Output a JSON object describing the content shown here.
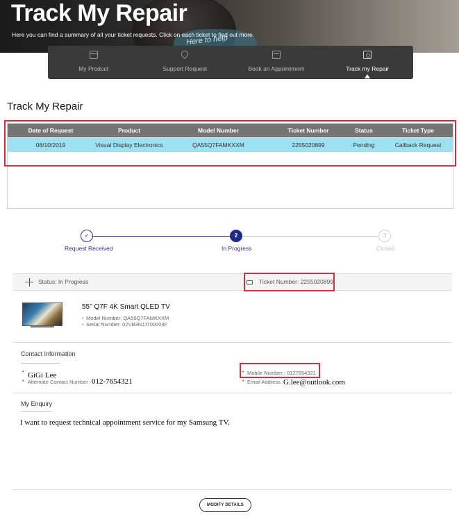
{
  "hero": {
    "title": "Track My Repair",
    "subtitle": "Here you can find a summary of all your ticket requests. Click on each ticket to find out more.",
    "shirt_text": "Here to help"
  },
  "tabs": [
    {
      "label": "My Product",
      "icon": "box-icon",
      "active": false
    },
    {
      "label": "Support Request",
      "icon": "location-pin-icon",
      "active": false
    },
    {
      "label": "Book an Appointment",
      "icon": "calendar-icon",
      "active": false
    },
    {
      "label": "Track my Repair",
      "icon": "clock-icon",
      "active": true
    }
  ],
  "section_title": "Track My Repair",
  "table": {
    "headers": [
      "Date of Request",
      "Product",
      "Model Number",
      "Ticket Number",
      "Status",
      "Ticket Type"
    ],
    "rows": [
      [
        "08/10/2019",
        "Visual Display Electronics",
        "QA55Q7FAMKXXM",
        "2255020899",
        "Pending",
        "Callback Request"
      ]
    ]
  },
  "progress": {
    "steps": [
      {
        "number": "✓",
        "label": "Request Received",
        "state": "done"
      },
      {
        "number": "2",
        "label": "In Progress",
        "state": "current"
      },
      {
        "number": "3",
        "label": "Closed",
        "state": "pending"
      }
    ]
  },
  "status": {
    "status_text": "Status: In Progress",
    "ticket_text": "Ticket Number: 2255020899"
  },
  "product": {
    "name": "55\" Q7F 4K Smart QLED TV",
    "model": "Model Number: QA55Q7FAMKXXM",
    "serial": "Serial Number: 02VB3NJJ700004F"
  },
  "contact": {
    "title": "Contact Information",
    "name": "GiGi Lee",
    "alt_label": "Alternate Contact Number :",
    "alt_value": "012-7654321",
    "mobile_label": "Mobile Number : 0127654321",
    "email_label": "Email Address :",
    "email_value": "G.lee@outlook.com"
  },
  "enquiry": {
    "title": "My Enquiry",
    "text": "I want to request technical appointment service for my Samsung TV."
  },
  "modify_button": "MODIFY DETAILS",
  "colors": {
    "highlight": "#d0313c",
    "accent_blue": "#1f2a85",
    "row_highlight": "#9ce0f2"
  }
}
